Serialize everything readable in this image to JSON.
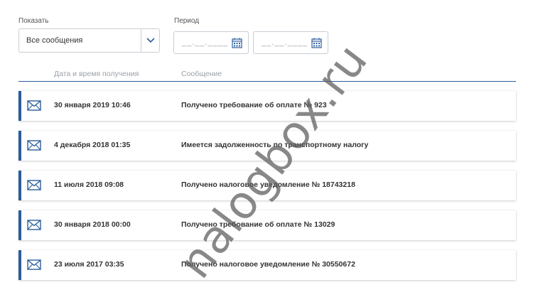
{
  "filters": {
    "show_label": "Показать",
    "show_value": "Все сообщения",
    "period_label": "Период",
    "date_from_placeholder": "__.__.____",
    "date_to_placeholder": "__.__.____"
  },
  "list": {
    "col_date": "Дата и время получения",
    "col_message": "Сообщение",
    "items": [
      {
        "date": "30 января 2019 10:46",
        "message": "Получено требование об оплате № 923",
        "icon": "envelope-icon"
      },
      {
        "date": "4 декабря 2018 01:35",
        "message": "Имеется задолженность по транспортному налогу",
        "icon": "envelope-icon"
      },
      {
        "date": "11 июля 2018 09:08",
        "message": "Получено налоговое уведомление № 18743218",
        "icon": "envelope-icon"
      },
      {
        "date": "30 января 2018 00:00",
        "message": "Получено требование об оплате № 13029",
        "icon": "envelope-icon"
      },
      {
        "date": "23 июля 2017 03:35",
        "message": "Получено налоговое уведомление № 30550672",
        "icon": "envelope-icon"
      }
    ]
  },
  "watermark": "nalogbox.ru",
  "colors": {
    "accent": "#2b5d9c",
    "border": "#c9cdd4",
    "muted": "#9aa0a8"
  }
}
